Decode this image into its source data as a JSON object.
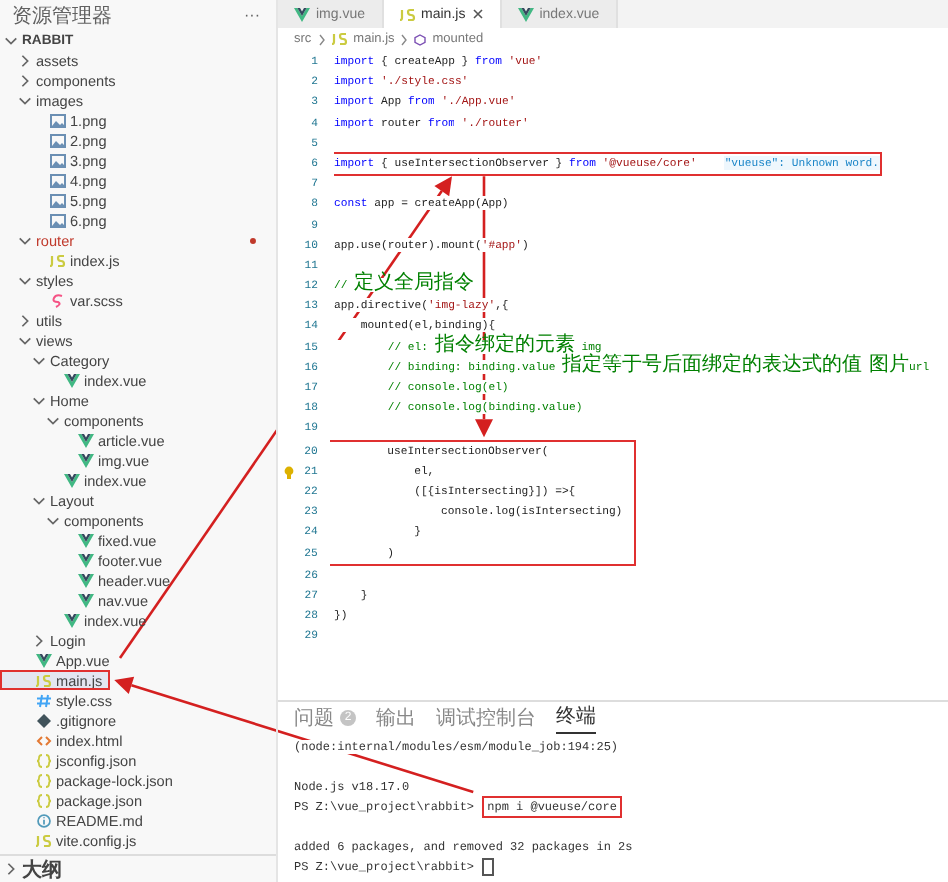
{
  "sidebar": {
    "title": "资源管理器",
    "more": "···",
    "tree": [
      {
        "label": "RABBIT",
        "kind": "folder",
        "expanded": true,
        "children": [
          {
            "label": "assets",
            "kind": "folder",
            "expanded": false
          },
          {
            "label": "components",
            "kind": "folder",
            "expanded": false
          },
          {
            "label": "images",
            "kind": "folder",
            "expanded": true,
            "children": [
              {
                "label": "1.png",
                "kind": "image"
              },
              {
                "label": "2.png",
                "kind": "image"
              },
              {
                "label": "3.png",
                "kind": "image"
              },
              {
                "label": "4.png",
                "kind": "image"
              },
              {
                "label": "5.png",
                "kind": "image"
              },
              {
                "label": "6.png",
                "kind": "image"
              }
            ]
          },
          {
            "label": "router",
            "kind": "folder",
            "expanded": true,
            "error": true,
            "children": [
              {
                "label": "index.js",
                "kind": "js"
              }
            ]
          },
          {
            "label": "styles",
            "kind": "folder",
            "expanded": true,
            "children": [
              {
                "label": "var.scss",
                "kind": "scss"
              }
            ]
          },
          {
            "label": "utils",
            "kind": "folder",
            "expanded": false
          },
          {
            "label": "views",
            "kind": "folder",
            "expanded": true,
            "children": [
              {
                "label": "Category",
                "kind": "folder",
                "expanded": true,
                "children": [
                  {
                    "label": "index.vue",
                    "kind": "vue"
                  }
                ]
              },
              {
                "label": "Home",
                "kind": "folder",
                "expanded": true,
                "children": [
                  {
                    "label": "components",
                    "kind": "folder",
                    "expanded": true,
                    "children": [
                      {
                        "label": "article.vue",
                        "kind": "vue"
                      },
                      {
                        "label": "img.vue",
                        "kind": "vue"
                      }
                    ]
                  },
                  {
                    "label": "index.vue",
                    "kind": "vue"
                  }
                ]
              },
              {
                "label": "Layout",
                "kind": "folder",
                "expanded": true,
                "children": [
                  {
                    "label": "components",
                    "kind": "folder",
                    "expanded": true,
                    "children": [
                      {
                        "label": "fixed.vue",
                        "kind": "vue"
                      },
                      {
                        "label": "footer.vue",
                        "kind": "vue"
                      },
                      {
                        "label": "header.vue",
                        "kind": "vue"
                      },
                      {
                        "label": "nav.vue",
                        "kind": "vue"
                      }
                    ]
                  },
                  {
                    "label": "index.vue",
                    "kind": "vue"
                  }
                ]
              },
              {
                "label": "Login",
                "kind": "folder",
                "expanded": false
              }
            ]
          },
          {
            "label": "App.vue",
            "kind": "vue"
          },
          {
            "label": "main.js",
            "kind": "js",
            "selected": true,
            "boxed": true
          },
          {
            "label": "style.css",
            "kind": "css"
          },
          {
            "label": ".gitignore",
            "kind": "git"
          },
          {
            "label": "index.html",
            "kind": "html"
          },
          {
            "label": "jsconfig.json",
            "kind": "json"
          },
          {
            "label": "package-lock.json",
            "kind": "json"
          },
          {
            "label": "package.json",
            "kind": "json"
          },
          {
            "label": "README.md",
            "kind": "info"
          },
          {
            "label": "vite.config.js",
            "kind": "js"
          }
        ]
      }
    ],
    "outline": {
      "label": "大纲",
      "expanded": false
    }
  },
  "tabs": [
    {
      "label": "img.vue",
      "kind": "vue",
      "selected": false
    },
    {
      "label": "main.js",
      "kind": "js",
      "selected": true
    },
    {
      "label": "index.vue",
      "kind": "vue",
      "selected": false
    }
  ],
  "breadcrumb": [
    "src",
    "main.js",
    "mounted"
  ],
  "code": [
    {
      "n": "1",
      "segs": [
        {
          "kind": "keyword",
          "text": "import"
        },
        {
          "kind": "plain",
          "text": " { createApp } "
        },
        {
          "kind": "keyword",
          "text": "from"
        },
        {
          "kind": "string",
          "text": " 'vue'"
        }
      ]
    },
    {
      "n": "2",
      "segs": [
        {
          "kind": "keyword",
          "text": "import"
        },
        {
          "kind": "string",
          "text": " './style.css'"
        }
      ]
    },
    {
      "n": "3",
      "segs": [
        {
          "kind": "keyword",
          "text": "import"
        },
        {
          "kind": "plain",
          "text": " App "
        },
        {
          "kind": "keyword",
          "text": "from"
        },
        {
          "kind": "string",
          "text": " './App.vue'"
        }
      ]
    },
    {
      "n": "4",
      "segs": [
        {
          "kind": "keyword",
          "text": "import"
        },
        {
          "kind": "plain",
          "text": " router "
        },
        {
          "kind": "keyword",
          "text": "from"
        },
        {
          "kind": "string",
          "text": " './router'"
        }
      ]
    },
    {
      "n": "5"
    },
    {
      "n": "6",
      "boxed": true,
      "segs": [
        {
          "kind": "keyword",
          "text": "import"
        },
        {
          "kind": "plain",
          "text": " { useIntersectionObserver } "
        },
        {
          "kind": "keyword",
          "text": "from"
        },
        {
          "kind": "string",
          "text": " '@vueuse/core'"
        },
        {
          "kind": "hint",
          "text": "\"vueuse\": Unknown word."
        }
      ]
    },
    {
      "n": "7"
    },
    {
      "n": "8",
      "segs": [
        {
          "kind": "keyword",
          "text": "const"
        },
        {
          "kind": "plain",
          "text": " app = createApp(App)"
        }
      ]
    },
    {
      "n": "9"
    },
    {
      "n": "10",
      "segs": [
        {
          "kind": "plain",
          "text": "app.use(router).mount("
        },
        {
          "kind": "string",
          "text": "'#app'"
        },
        {
          "kind": "plain",
          "text": ")"
        }
      ]
    },
    {
      "n": "11"
    },
    {
      "n": "12",
      "segs": [
        {
          "kind": "comment",
          "text": "// 定义全局指令"
        }
      ]
    },
    {
      "n": "13",
      "segs": [
        {
          "kind": "plain",
          "text": "app.directive("
        },
        {
          "kind": "string",
          "text": "'img-lazy'"
        },
        {
          "kind": "plain",
          "text": ",{"
        }
      ]
    },
    {
      "n": "14",
      "segs": [
        {
          "kind": "plain",
          "text": "    mounted(el,binding){"
        }
      ]
    },
    {
      "n": "15",
      "segs": [
        {
          "kind": "comment",
          "text": "        // el: 指令绑定的元素 img"
        }
      ]
    },
    {
      "n": "16",
      "segs": [
        {
          "kind": "comment",
          "text": "        // binding: binding.value 指定等于号后面绑定的表达式的值 图片url"
        }
      ]
    },
    {
      "n": "17",
      "segs": [
        {
          "kind": "comment",
          "text": "        // console.log(el)"
        }
      ]
    },
    {
      "n": "18",
      "segs": [
        {
          "kind": "comment",
          "text": "        // console.log(binding.value)"
        }
      ]
    },
    {
      "n": "19"
    },
    {
      "n": "20",
      "boxed": true,
      "segs": [
        {
          "kind": "plain",
          "text": "        useIntersectionObserver("
        }
      ]
    },
    {
      "n": "21",
      "boxed": true,
      "bulb": true,
      "segs": [
        {
          "kind": "plain",
          "text": "            el,"
        }
      ]
    },
    {
      "n": "22",
      "boxed": true,
      "segs": [
        {
          "kind": "plain",
          "text": "            ([{isIntersecting}]) =>{"
        }
      ]
    },
    {
      "n": "23",
      "boxed": true,
      "segs": [
        {
          "kind": "plain",
          "text": "                console.log(isIntersecting)"
        }
      ]
    },
    {
      "n": "24",
      "boxed": true,
      "segs": [
        {
          "kind": "plain",
          "text": "            }"
        }
      ]
    },
    {
      "n": "25",
      "boxed": true,
      "segs": [
        {
          "kind": "plain",
          "text": "        )"
        }
      ]
    },
    {
      "n": "26"
    },
    {
      "n": "27",
      "segs": [
        {
          "kind": "plain",
          "text": "    }"
        }
      ]
    },
    {
      "n": "28",
      "segs": [
        {
          "kind": "plain",
          "text": "})"
        }
      ]
    },
    {
      "n": "29"
    }
  ],
  "panel": {
    "tabs": [
      {
        "label": "问题",
        "badge": "2",
        "selected": false
      },
      {
        "label": "输出",
        "selected": false
      },
      {
        "label": "调试控制台",
        "selected": false
      },
      {
        "label": "终端",
        "selected": true
      }
    ],
    "terminal": [
      {
        "lines": [
          {
            "segs": [
              {
                "kind": "output",
                "text": "(node:internal/modules/esm/module_job:194:25)"
              }
            ]
          }
        ]
      },
      {
        "lines": [
          {
            "segs": [
              {
                "kind": "output",
                "text": "Node.js v18.17.0"
              }
            ]
          },
          {
            "segs": [
              {
                "kind": "prompt",
                "text": "PS Z:\\vue_project\\rabbit> "
              },
              {
                "kind": "command",
                "text": "npm i @vueuse/core",
                "boxed": true
              }
            ]
          }
        ]
      },
      {
        "lines": [
          {
            "segs": [
              {
                "kind": "output",
                "text": "added 6 packages, and removed 32 packages in 2s"
              }
            ]
          },
          {
            "segs": [
              {
                "kind": "prompt",
                "text": "PS Z:\\vue_project\\rabbit> "
              },
              {
                "kind": "cursor"
              }
            ]
          }
        ]
      }
    ]
  }
}
